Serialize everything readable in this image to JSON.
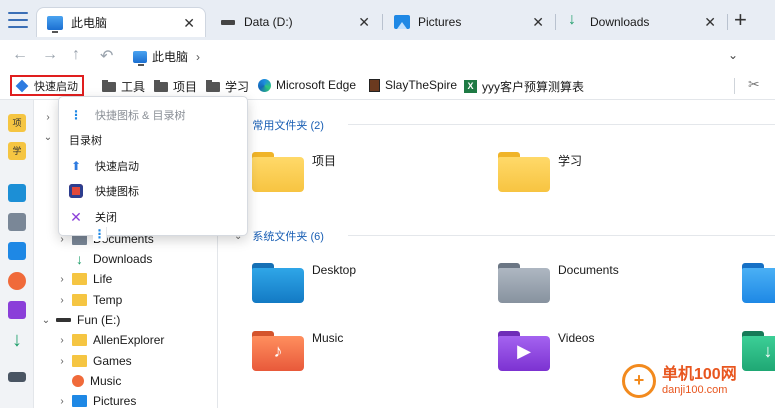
{
  "tabs": [
    {
      "label": "此电脑",
      "icon": "pc-icon"
    },
    {
      "label": "Data (D:)",
      "icon": "drive-icon"
    },
    {
      "label": "Pictures",
      "icon": "pictures-icon"
    },
    {
      "label": "Downloads",
      "icon": "download-icon"
    }
  ],
  "tab_close_glyph": "✕",
  "new_tab_glyph": "+",
  "nav": {
    "back_glyph": "←",
    "forward_glyph": "→",
    "up_glyph": "↑",
    "history_glyph": "↶",
    "breadcrumb": "此电脑",
    "breadcrumb_chevron": "›",
    "dropdown_glyph": "⌄"
  },
  "bookmarks": {
    "quick_launch": "快速启动",
    "items": [
      "工具",
      "项目",
      "学习",
      "Microsoft Edge",
      "SlayTheSpire",
      "yyy客户预算测算表"
    ],
    "scissors_glyph": "✂"
  },
  "rail": {
    "project_badge": "项",
    "study_badge": "学",
    "download_glyph": "↓"
  },
  "tree": {
    "rows": [
      {
        "arrow": "›",
        "label": ""
      },
      {
        "arrow": "⌄",
        "label": ""
      },
      {
        "arrow": "›",
        "label": "Documents"
      },
      {
        "arrow": "",
        "label": "Downloads"
      },
      {
        "arrow": "›",
        "label": "Life"
      },
      {
        "arrow": "›",
        "label": "Temp"
      },
      {
        "arrow": "⌄",
        "label": "Fun (E:)"
      },
      {
        "arrow": "›",
        "label": "AllenExplorer"
      },
      {
        "arrow": "›",
        "label": "Games"
      },
      {
        "arrow": "",
        "label": "Music"
      },
      {
        "arrow": "›",
        "label": "Pictures"
      }
    ],
    "download_glyph": "↓"
  },
  "content": {
    "groups": [
      {
        "title": "常用文件夹 (2)",
        "chevron": "⌄"
      },
      {
        "title": "系统文件夹 (6)",
        "chevron": "⌄"
      }
    ],
    "common_folders": [
      "项目",
      "学习"
    ],
    "system_folders": [
      "Desktop",
      "Documents",
      "Music",
      "Videos"
    ],
    "glyphs": {
      "music": "♪",
      "video": "▶",
      "download": "↓"
    }
  },
  "menu": {
    "items": [
      {
        "label": "快捷图标 & 目录树",
        "icon": "tree-icon",
        "disabled": true
      },
      {
        "label": "目录树",
        "icon": "tree-icon",
        "disabled": false
      },
      {
        "label": "快速启动",
        "icon": "rocket-icon",
        "disabled": false
      },
      {
        "label": "快捷图标",
        "icon": "shortcut-icon",
        "disabled": false
      },
      {
        "label": "关闭",
        "icon": "close-icon",
        "disabled": false
      }
    ],
    "glyphs": {
      "tree": "⋮",
      "rocket": "⬆",
      "close": "✕"
    }
  },
  "watermark": {
    "logo_glyph": "+",
    "line1": "单机100网",
    "line2": "danji100.com"
  },
  "colors": {
    "accent": "#1a5fb4",
    "highlight_border": "#e01e1e",
    "folder_yellow": "#f7c441"
  }
}
